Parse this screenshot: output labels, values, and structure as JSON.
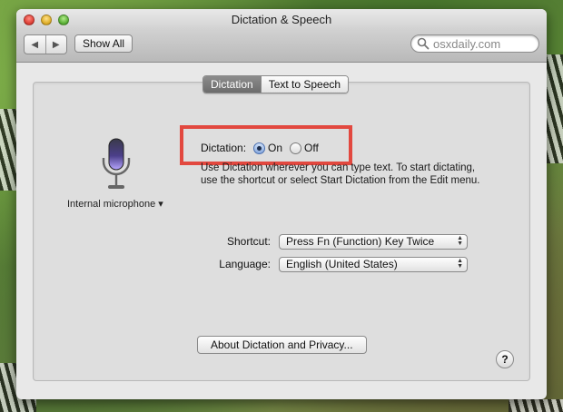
{
  "window": {
    "title": "Dictation & Speech"
  },
  "toolbar": {
    "back_glyph": "◀",
    "forward_glyph": "▶",
    "show_all_label": "Show All",
    "search_text": "osxdaily.com",
    "search_icon": "search-icon"
  },
  "tabs": [
    {
      "label": "Dictation",
      "active": true
    },
    {
      "label": "Text to Speech",
      "active": false
    }
  ],
  "mic": {
    "label": "Internal microphone ▾",
    "icon": "microphone-icon"
  },
  "dictation": {
    "label": "Dictation:",
    "on_label": "On",
    "off_label": "Off",
    "selected": "On",
    "description": "Use Dictation wherever you can type text. To start dictating, use the shortcut or select Start Dictation from the Edit menu."
  },
  "shortcut": {
    "label": "Shortcut:",
    "value": "Press Fn (Function) Key Twice"
  },
  "language": {
    "label": "Language:",
    "value": "English (United States)"
  },
  "about_button": "About Dictation and Privacy...",
  "help_glyph": "?",
  "colors": {
    "highlight": "#e2483f",
    "active_tab": "#7a7a7a",
    "radio_selected": "#86a8dd"
  }
}
